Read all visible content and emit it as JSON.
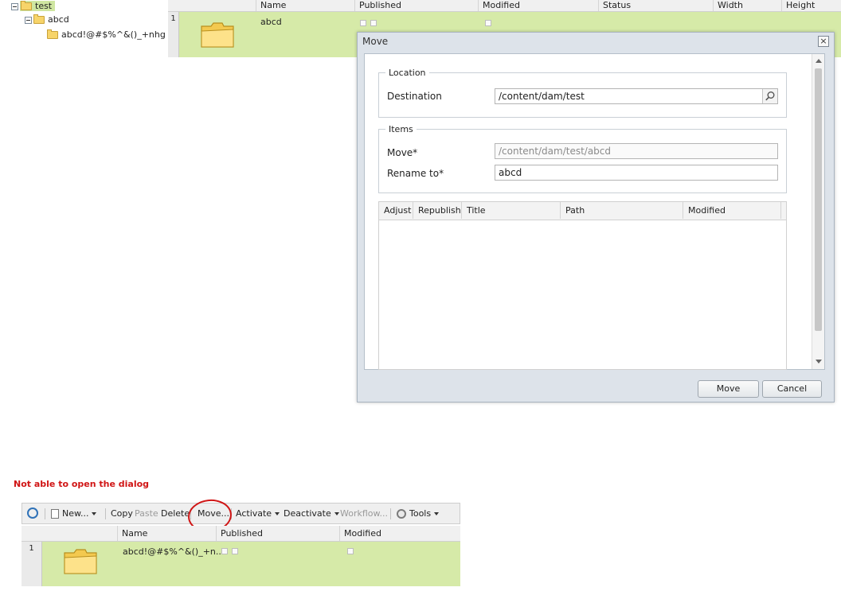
{
  "tree": {
    "items": [
      {
        "label": "test"
      },
      {
        "label": "abcd"
      },
      {
        "label": "abcd!@#$%^&()_+nhg"
      }
    ]
  },
  "top_grid": {
    "columns": [
      "Name",
      "Published",
      "Modified",
      "Status",
      "Width",
      "Height"
    ],
    "row": {
      "number": "1",
      "name": "abcd"
    }
  },
  "dialog": {
    "title": "Move",
    "close_glyph": "×",
    "location_legend": "Location",
    "destination_label": "Destination",
    "destination_value": "/content/dam/test",
    "items_legend": "Items",
    "move_label": "Move*",
    "move_value": "/content/dam/test/abcd",
    "rename_label": "Rename to*",
    "rename_value": "abcd",
    "grid_columns": [
      "Adjust",
      "Republish",
      "Title",
      "Path",
      "Modified"
    ],
    "move_button": "Move",
    "cancel_button": "Cancel"
  },
  "annotation": {
    "text": "Not able to open the dialog",
    "color": "#d01515"
  },
  "toolbar": {
    "new": "New...",
    "copy": "Copy",
    "paste": "Paste",
    "delete": "Delete",
    "move": "Move...",
    "activate": "Activate",
    "deactivate": "Deactivate",
    "workflow": "Workflow...",
    "tools": "Tools"
  },
  "bottom_grid": {
    "columns": [
      "Name",
      "Published",
      "Modified"
    ],
    "row": {
      "number": "1",
      "name": "abcd!@#$%^&()_+n..."
    }
  },
  "colors": {
    "selected_row": "#d6eaa8",
    "folder": "#f7d46a"
  }
}
